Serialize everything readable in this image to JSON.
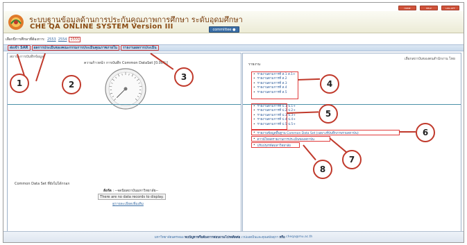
{
  "top_buttons": [
    "HOME",
    "HELP",
    "LOG-OFF"
  ],
  "header": {
    "title_th": "ระบบฐานข้อมูลด้านการประกันคุณภาพการศึกษา ระดับอุดมศึกษา",
    "title_en": "CHE QA ONLINE SYSTEM Version III",
    "committee_label": "committee"
  },
  "year_row": {
    "label": "เลือกปีการศึกษาที่ต้องการ:",
    "years": [
      "2553",
      "2554",
      "2555"
    ],
    "active_year": "2555"
  },
  "nav": {
    "tabs": [
      "ส่งเข้า SAR",
      "ผลการประเมินของคณะกรรมการประเมินคุณภาพภายใน",
      "รายงานผลการประเมิน"
    ]
  },
  "left_panel": {
    "section_title": "สถานะการบันทึกข้อมูล",
    "progress_label": "ความก้าวหน้า  การบันทึก  Common DataSet [0.00%]",
    "progress_percent": 0,
    "cds_title": "Common Data Set ที่ยังไม่ได้กรอก",
    "cds_inst_label": "สังกัด",
    "cds_inst_value": ": --จดนิยสถาบันมหาวิทยาลัย--",
    "cds_box": "There are no data records to display.",
    "cds_link": "ดูรายละเอียดเพิ่มเติม"
  },
  "right_panel": {
    "head": "เลือกสถาบันของตนสำนักงาน  ไทย",
    "reports_label": "รายงาน",
    "group1": [
      "รายงานตามการที่ ส.1 ส.1+",
      "รายงานตามการที่ ส.2",
      "รายงานตามการที่ ส.3",
      "รายงานตามการที่ ส.4",
      "รายงานตามการที่ ส.5"
    ],
    "group2": [
      "รายงานตามการที่ ป.1 ป.1+",
      "รายงานตามการที่ ป.2 ป.2+",
      "รายงานตามการที่ ป.3 ป.3+",
      "รายงานตามการที่ ป.4 ป.4+",
      "รายงานตามการที่ ป.5 ป.5+"
    ],
    "cds_report": "รายงานข้อมูลพื้นฐาน Common Data Set (เฉพาะที่บันทึกภาพรวมสถาบัน)",
    "download": "ดาวน์โหลดรายงานการประเมินของสถาบัน",
    "university": "ปรับปรุงรหัสมหาวิทยาลัย"
  },
  "callouts": [
    "1",
    "2",
    "3",
    "4",
    "5",
    "6",
    "7",
    "8"
  ],
  "footer": {
    "text_a": "มหาวิทยาลัยนครพนม",
    "text_b": "พบปัญหาหรือต้องการสอบถามโปรดติดต่อ",
    "text_c": "เวปแอดมินและคุณสมัยสุภา",
    "text_d": "หรือ",
    "text_e": "cheqa@mu.ac.th"
  },
  "colors": {
    "accent_red": "#c0392b",
    "link_blue": "#3b6ea5",
    "header_brown": "#7a3e0e"
  }
}
